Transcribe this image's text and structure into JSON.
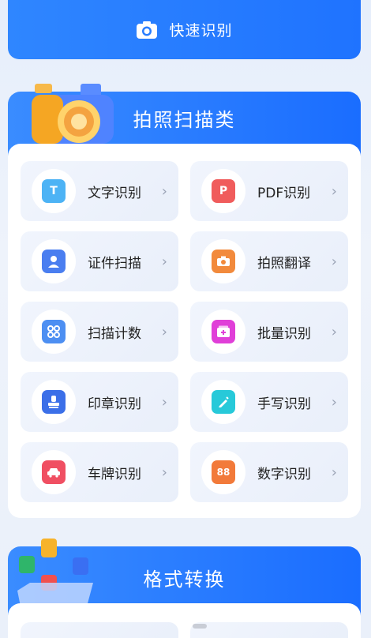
{
  "quick": {
    "label": "快速识别",
    "icon": "camera-icon"
  },
  "photo_section": {
    "title": "拍照扫描类",
    "items": [
      {
        "label": "文字识别",
        "icon": "text-scan-icon",
        "color": "#4db3f5",
        "glyph": "T"
      },
      {
        "label": "PDF识别",
        "icon": "pdf-icon",
        "color": "#f05c5c",
        "glyph": "P"
      },
      {
        "label": "证件扫描",
        "icon": "id-card-icon",
        "color": "#4a7ef0",
        "glyph": "◘"
      },
      {
        "label": "拍照翻译",
        "icon": "photo-translate-icon",
        "color": "#f28a3c",
        "glyph": "◙"
      },
      {
        "label": "扫描计数",
        "icon": "count-icon",
        "color": "#4d8ff2",
        "glyph": "⁘"
      },
      {
        "label": "批量识别",
        "icon": "batch-icon",
        "color": "#e03fd8",
        "glyph": "+"
      },
      {
        "label": "印章识别",
        "icon": "seal-icon",
        "color": "#3b6fe8",
        "glyph": "⊥"
      },
      {
        "label": "手写识别",
        "icon": "handwriting-icon",
        "color": "#27c9d9",
        "glyph": "✎"
      },
      {
        "label": "车牌识别",
        "icon": "license-plate-icon",
        "color": "#f04f62",
        "glyph": "▬"
      },
      {
        "label": "数字识别",
        "icon": "number-icon",
        "color": "#f27a3a",
        "glyph": "88"
      }
    ]
  },
  "format_section": {
    "title": "格式转换"
  }
}
